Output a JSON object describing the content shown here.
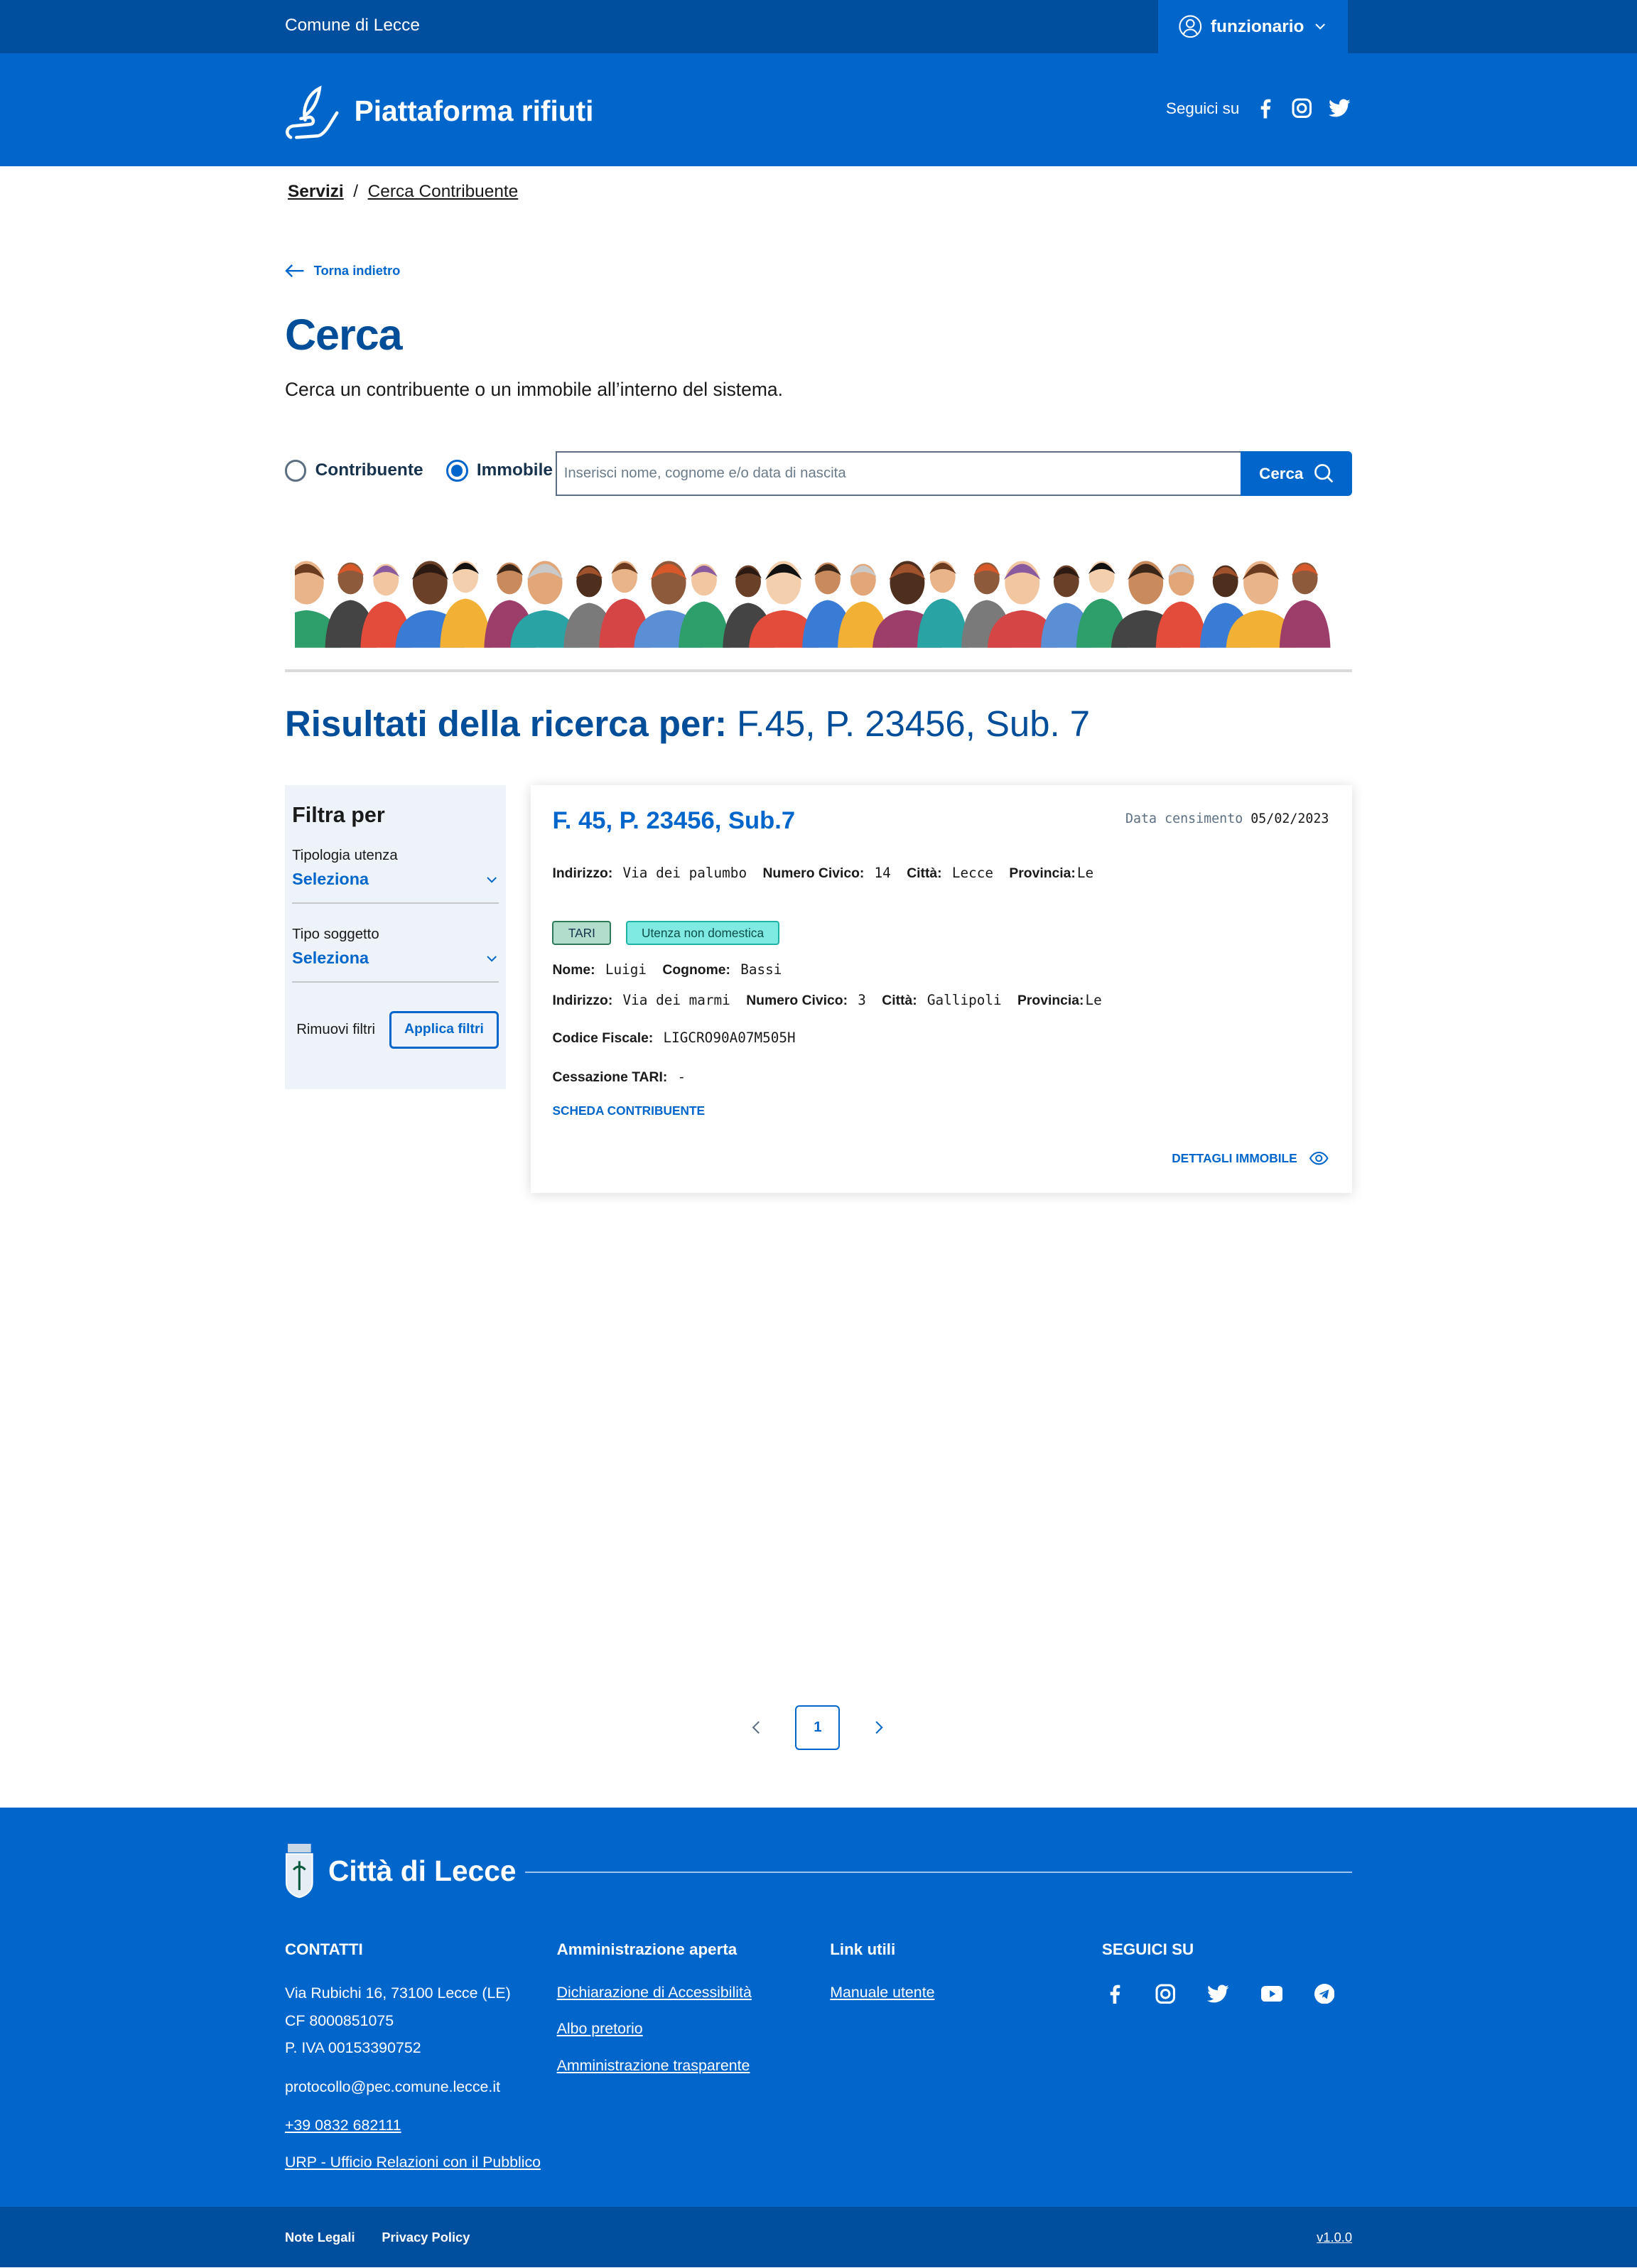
{
  "topbar": {
    "city": "Comune di Lecce",
    "user": "funzionario"
  },
  "header": {
    "title": "Piattaforma rifiuti",
    "follow": "Seguici su"
  },
  "breadcrumb": [
    "Servizi",
    "Cerca Contribuente"
  ],
  "back": "Torna indietro",
  "page": {
    "title": "Cerca",
    "description": "Cerca un contribuente o un immobile all’interno del sistema."
  },
  "search": {
    "options": [
      "Contribuente",
      "Immobile"
    ],
    "selected": "Immobile",
    "placeholder": "Inserisci nome, cognome e/o data di nascita",
    "button": "Cerca"
  },
  "results": {
    "label": "Risultati della ricerca per:",
    "query": "F.45, P. 23456, Sub. 7"
  },
  "filters": {
    "title": "Filtra per",
    "groups": [
      {
        "label": "Tipologia utenza",
        "value": "Seleziona"
      },
      {
        "label": "Tipo soggetto",
        "value": "Seleziona"
      }
    ],
    "remove": "Rimuovi filtri",
    "apply": "Applica filtri"
  },
  "card": {
    "title": "F. 45, P. 23456, Sub.7",
    "date_label": "Data censimento",
    "date": "05/02/2023",
    "property": {
      "indirizzo_l": "Indirizzo:",
      "indirizzo": "Via dei palumbo",
      "civico_l": "Numero Civico:",
      "civico": "14",
      "citta_l": "Città:",
      "citta": "Lecce",
      "prov_l": "Provincia:",
      "prov": "Le"
    },
    "badges": [
      "TARI",
      "Utenza non domestica"
    ],
    "person": {
      "nome_l": "Nome:",
      "nome": "Luigi",
      "cognome_l": "Cognome:",
      "cognome": "Bassi",
      "indirizzo_l": "Indirizzo:",
      "indirizzo": "Via dei marmi",
      "civico_l": "Numero Civico:",
      "civico": "3",
      "citta_l": "Città:",
      "citta": "Gallipoli",
      "prov_l": "Provincia:",
      "prov": "Le",
      "cf_l": "Codice Fiscale:",
      "cf": "LIGCRO90A07M505H",
      "cess_l": "Cessazione TARI:",
      "cess": "-"
    },
    "link_contribuente": "SCHEDA CONTRIBUENTE",
    "link_immobile": "DETTAGLI IMMOBILE"
  },
  "pagination": {
    "current": "1"
  },
  "footer": {
    "brand": "Città di Lecce",
    "contacts": {
      "title": "CONTATTI",
      "address": "Via Rubichi 16, 73100 Lecce (LE)",
      "cf": "CF 8000851075",
      "piva": "P. IVA 00153390752",
      "pec": "protocollo@pec.comune.lecce.it",
      "phone": "+39 0832 682111",
      "urp": "URP - Ufficio Relazioni con il Pubblico"
    },
    "admin": {
      "title": "Amministrazione aperta",
      "links": [
        "Dichiarazione di Accessibilità",
        "Albo pretorio",
        "Amministrazione trasparente"
      ]
    },
    "useful": {
      "title": "Link utili",
      "links": [
        "Manuale utente"
      ]
    },
    "social": {
      "title": "SEGUICI SU",
      "icons": [
        "facebook",
        "instagram",
        "twitter",
        "youtube",
        "telegram"
      ]
    },
    "bottom": {
      "legal": "Note Legali",
      "privacy": "Privacy Policy",
      "version": "v1.0.0"
    }
  },
  "colors": {
    "primary": "#0066cc",
    "dark": "#004f9f"
  }
}
